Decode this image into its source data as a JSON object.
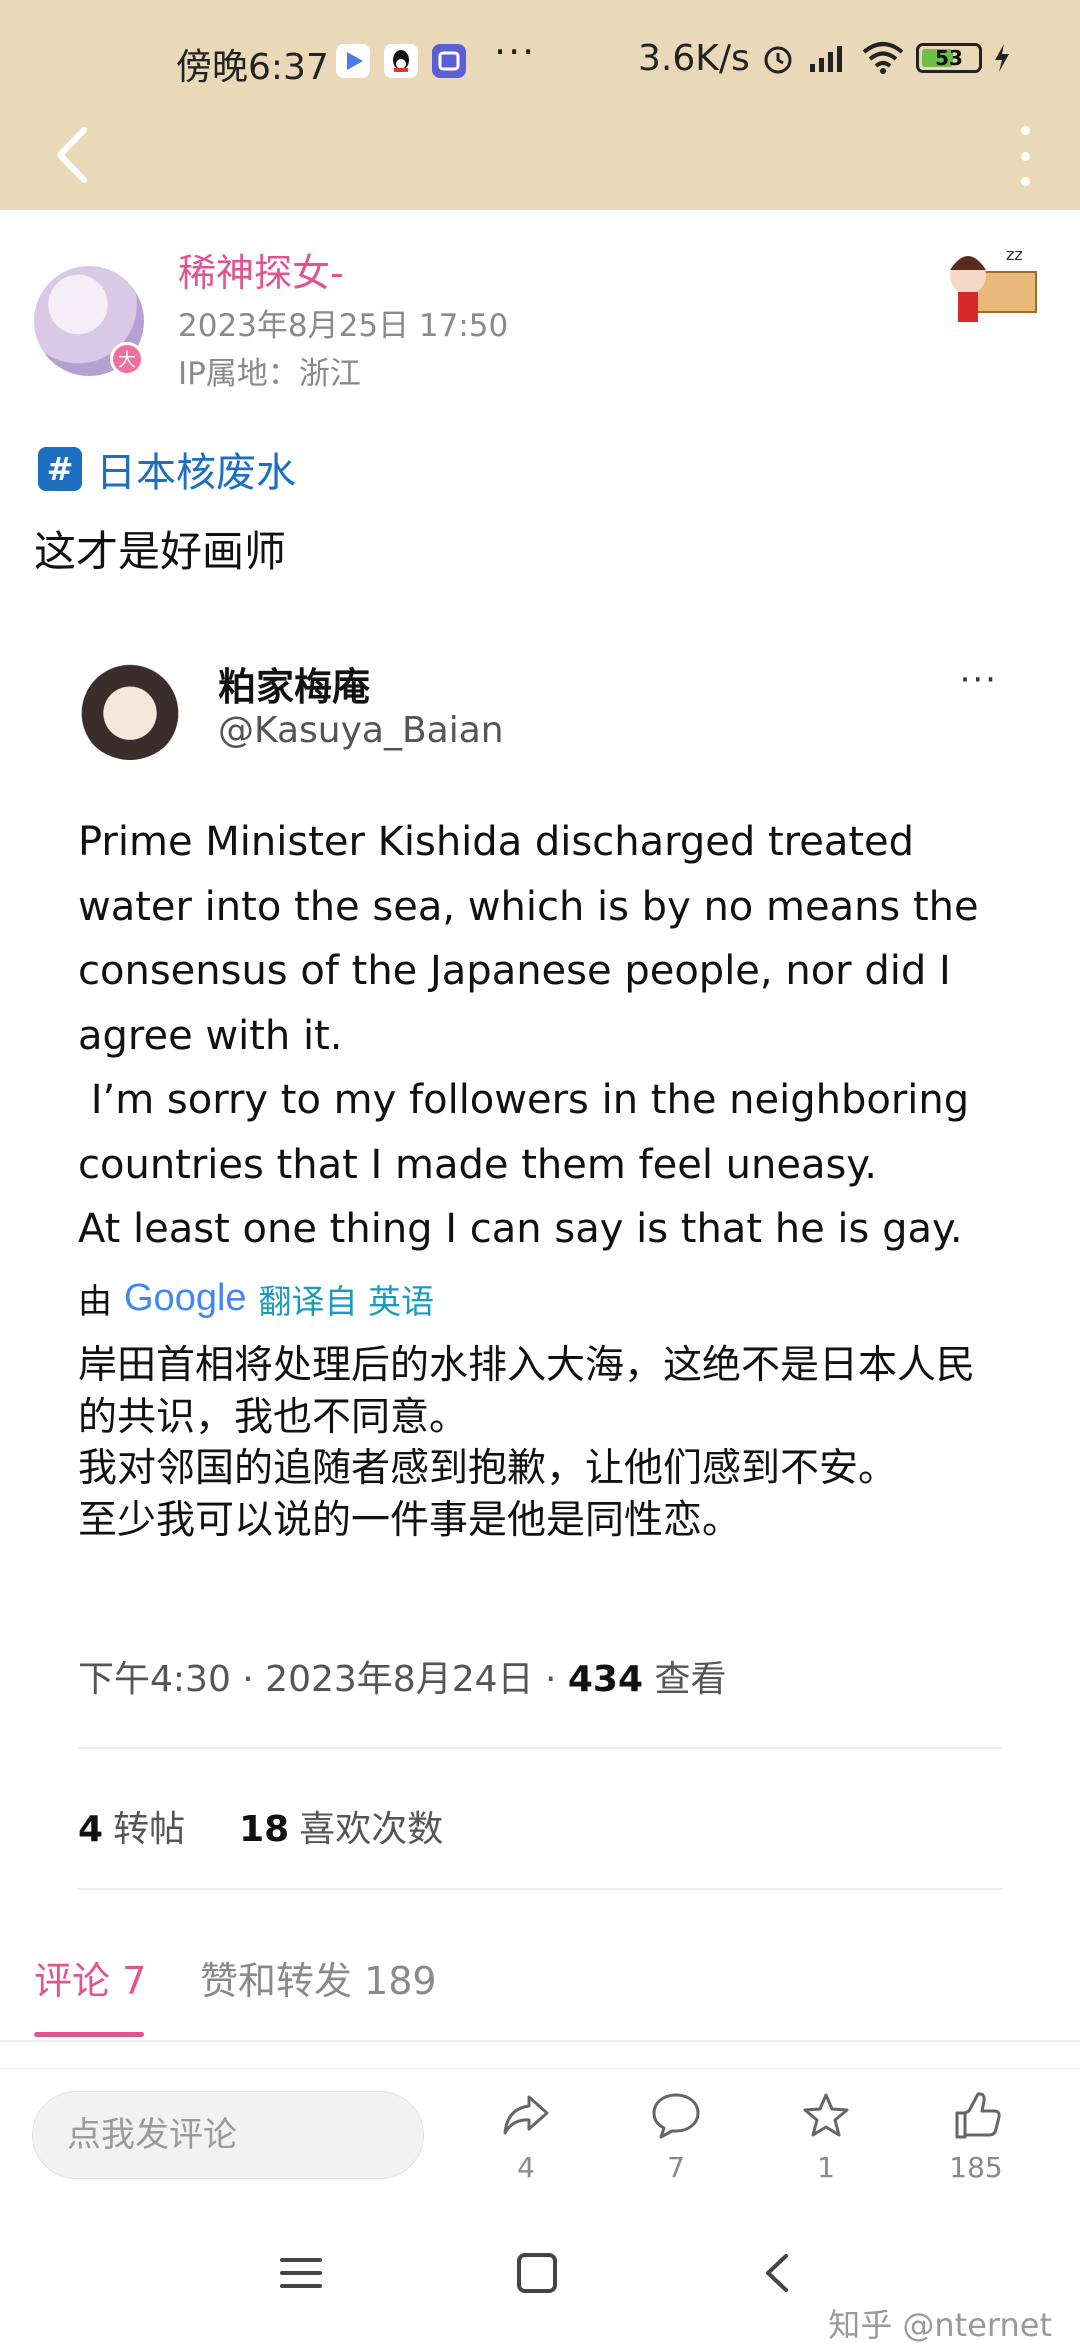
{
  "status_bar": {
    "time": "傍晚6:37",
    "more_indicator": "···",
    "net_speed": "3.6K/s",
    "battery": "53"
  },
  "post": {
    "author_name": "稀神探女-",
    "author_badge": "大",
    "date": "2023年8月25日 17:50",
    "ip_location": "IP属地：浙江",
    "topic": "日本核废水",
    "text": "这才是好画师"
  },
  "tweet": {
    "display_name": "粕家梅庵",
    "handle": "@Kasuya_Baian",
    "more": "···",
    "text_en": "Prime Minister Kishida discharged treated water into the sea, which is by no means the consensus of the Japanese people, nor did I agree with it.\n I’m sorry to my followers in the neighboring countries that I made them feel uneasy.\nAt least one thing I can say is that he is gay.",
    "translated_by_prefix": "由",
    "translator": "Google",
    "translated_from": "翻译自 英语",
    "text_zh": "岸田首相将处理后的水排入大海，这绝不是日本人民的共识，我也不同意。\n我对邻国的追随者感到抱歉，让他们感到不安。\n至少我可以说的一件事是他是同性恋。",
    "meta_time": "下午4:30 · 2023年8月24日 · ",
    "views_count": "434",
    "views_label": " 查看",
    "retweets_count": "4",
    "retweets_label": "转帖",
    "likes_count": "18",
    "likes_label": "喜欢次数"
  },
  "tabs": {
    "comments": "评论 7",
    "likes_reposts": "赞和转发 189"
  },
  "bottom_bar": {
    "comment_placeholder": "点我发评论",
    "share_count": "4",
    "comment_count": "7",
    "star_count": "1",
    "like_count": "185"
  },
  "watermark": "知乎 @nternet",
  "colors": {
    "header_bg": "#ead9b8",
    "accent_pink": "#e0558f",
    "topic_blue": "#1e6fbf"
  }
}
